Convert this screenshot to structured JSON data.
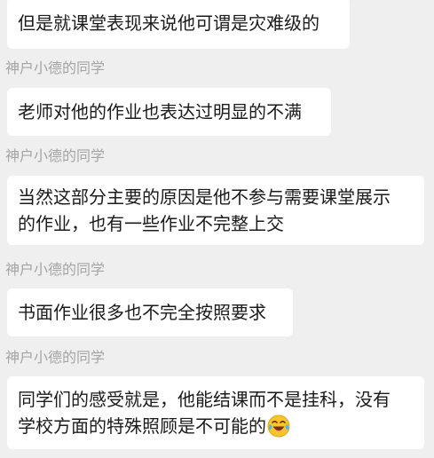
{
  "messages": [
    {
      "sender": "",
      "lines": [
        "但是就课堂表现来说他可谓是灾难级的"
      ]
    },
    {
      "sender": "神户小德的同学",
      "lines": [
        "老师对他的作业也表达过明显的不满"
      ]
    },
    {
      "sender": "神户小德的同学",
      "lines": [
        "当然这部分主要的原因是他不参与需要课堂展示",
        "的作业，也有一些作业不完整上交"
      ]
    },
    {
      "sender": "神户小德的同学",
      "lines": [
        "书面作业很多也不完全按照要求"
      ]
    },
    {
      "sender": "神户小德的同学",
      "lines": [
        "同学们的感受就是，他能结课而不是挂科，没有",
        "学校方面的特殊照顾是不可能的"
      ],
      "trailing_icon": "laughing-with-tears-emoji"
    }
  ],
  "colors": {
    "background": "#efefef",
    "bubble": "#ffffff",
    "text": "#1b1b1b",
    "sender_name": "#a5a5a5"
  }
}
